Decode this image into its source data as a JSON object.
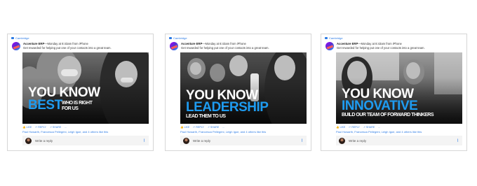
{
  "cards": [
    {
      "group": "Cambridge",
      "author": "Accenture ERP",
      "timestamp": "Monday at 8:43am from iPhone",
      "message": "Get rewarded for helping put one of your contacts into a great team.",
      "headline": {
        "line1": "YOU KNOW",
        "line2": "BEST",
        "tag1": "WHO IS RIGHT",
        "tag2": "FOR US"
      },
      "actions": {
        "like": "LIKE",
        "reply": "REPLY",
        "share": "SHARE",
        "more": "..."
      },
      "likes": "Paul Howarth, Francesca Pellegrini, Leigh Igoe, and 4 others like this",
      "reply_placeholder": "Write a reply"
    },
    {
      "group": "Cambridge",
      "author": "Accenture ERP",
      "timestamp": "Monday at 8:43am from iPhone",
      "message": "Get rewarded for helping put one of your contacts into a great team.",
      "headline": {
        "line1": "YOU KNOW",
        "line2": "LEADERSHIP",
        "tag1": "LEAD THEM TO US",
        "tag2": ""
      },
      "actions": {
        "like": "LIKE",
        "reply": "REPLY",
        "share": "SHARE",
        "more": "..."
      },
      "likes": "Paul Howarth, Francesca Pellegrini, Leigh Igoe, and 4 others like this",
      "reply_placeholder": "Write a reply"
    },
    {
      "group": "Cambridge",
      "author": "Accenture ERP",
      "timestamp": "Monday at 8:43am from iPhone",
      "message": "Get rewarded for helping put one of your contacts into a great team.",
      "headline": {
        "line1": "YOU KNOW",
        "line2": "INNOVATIVE",
        "tag1": "BUILD OUR TEAM OF FORWARD THINKERS",
        "tag2": ""
      },
      "actions": {
        "like": "LIKE",
        "reply": "REPLY",
        "share": "SHARE",
        "more": "..."
      },
      "likes": "Paul Howarth, Francesca Pellegrini, Leigh Igoe, and 4 others like this",
      "reply_placeholder": "Write a reply"
    }
  ],
  "colors": {
    "accent_blue": "#1e9bf0",
    "link_blue": "#2c7be5",
    "border": "#d6d6d6"
  },
  "icons": {
    "group": "group-icon",
    "like": "thumbs-up-icon",
    "reply": "reply-arrow-icon",
    "share": "share-icon",
    "attach": "paperclip-icon"
  }
}
